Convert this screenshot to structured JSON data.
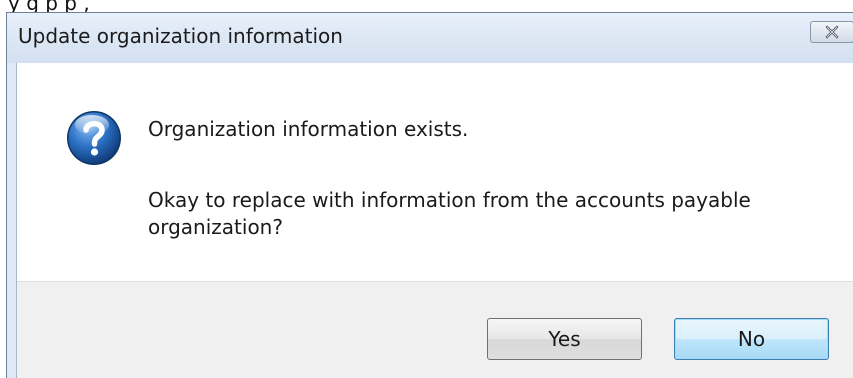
{
  "top_snippet": "y                          g p   p ,",
  "dialog": {
    "title": "Update organization information",
    "close_glyph": "×",
    "message_line1": "Organization information exists.",
    "message_line2": "Okay to replace with information from the accounts payable organization?",
    "icon": "question-icon",
    "buttons": {
      "yes_label": "Yes",
      "no_label": "No"
    }
  },
  "colors": {
    "titlebar": "#dbe6f4",
    "icon_blue": "#1e5fae",
    "default_button_border": "#3c7fb1"
  }
}
